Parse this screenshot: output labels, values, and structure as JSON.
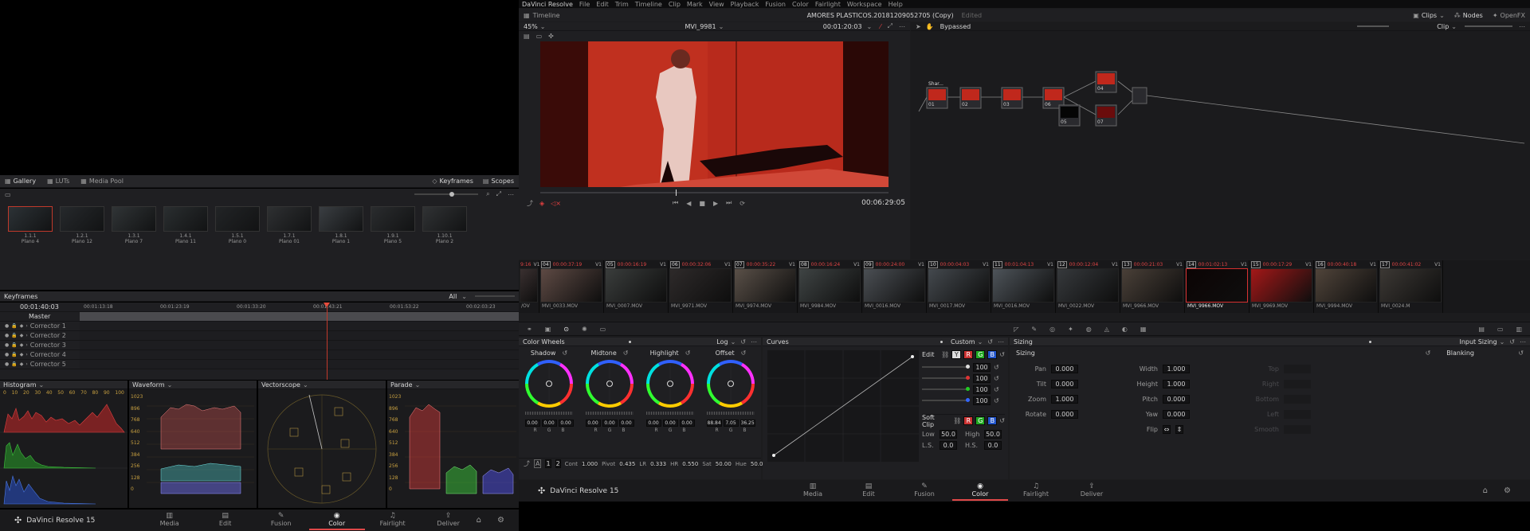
{
  "left": {
    "gallery_tabs": [
      {
        "label": "Gallery",
        "icon": "gallery-icon"
      },
      {
        "label": "LUTs",
        "icon": "lut-icon"
      },
      {
        "label": "Media Pool",
        "icon": "media-pool-icon"
      }
    ],
    "keyframes_btn": "Keyframes",
    "scopes_btn": "Scopes",
    "stills": [
      {
        "id": "1.1.1",
        "name": "Plano 4"
      },
      {
        "id": "1.2.1",
        "name": "Plano 12"
      },
      {
        "id": "1.3.1",
        "name": "Plano 7"
      },
      {
        "id": "1.4.1",
        "name": "Plano 11"
      },
      {
        "id": "1.5.1",
        "name": "Plano 0"
      },
      {
        "id": "1.7.1",
        "name": "Plano 01"
      },
      {
        "id": "1.8.1",
        "name": "Plano 1"
      },
      {
        "id": "1.9.1",
        "name": "Plano 5"
      },
      {
        "id": "1.10.1",
        "name": "Plano 2"
      }
    ],
    "keyframes": {
      "title": "Keyframes",
      "filter": "All",
      "timecode": "00:01:40:03",
      "ruler": [
        "00:01:13:18",
        "00:01:23:19",
        "00:01:33:20",
        "00:01:43:21",
        "00:01:53:22",
        "00:02:03:23"
      ],
      "tracks": [
        "Master",
        "Corrector 1",
        "Corrector 2",
        "Corrector 3",
        "Corrector 4",
        "Corrector 5"
      ]
    },
    "scopes": {
      "histogram": "Histogram",
      "histogram_axis": [
        "0",
        "10",
        "20",
        "30",
        "40",
        "50",
        "60",
        "70",
        "80",
        "90",
        "100"
      ],
      "waveform": "Waveform",
      "vectorscope": "Vectorscope",
      "parade": "Parade",
      "levels": [
        "1023",
        "896",
        "768",
        "640",
        "512",
        "384",
        "256",
        "128",
        "0"
      ]
    },
    "footer": {
      "app": "DaVinci Resolve 15",
      "pages": [
        "Media",
        "Edit",
        "Fusion",
        "Color",
        "Fairlight",
        "Deliver"
      ],
      "active": "Color"
    }
  },
  "menu": [
    "DaVinci Resolve",
    "File",
    "Edit",
    "Trim",
    "Timeline",
    "Clip",
    "Mark",
    "View",
    "Playback",
    "Fusion",
    "Color",
    "Fairlight",
    "Workspace",
    "Help"
  ],
  "titlebar": {
    "timeline": "Timeline",
    "project": "AMORES PLASTICOS.20181209052705 (Copy)",
    "status": "Edited",
    "clips": "Clips",
    "nodes": "Nodes",
    "openfx": "OpenFX"
  },
  "viewer": {
    "zoom": "45%",
    "clip": "MVI_9981",
    "tc_top": "00:01:20:03",
    "timecode": "00:06:29:05",
    "bypassed": "Bypassed",
    "clip_mode": "Clip"
  },
  "nodes": [
    {
      "num": "01",
      "label": "Shar..."
    },
    {
      "num": "02"
    },
    {
      "num": "03"
    },
    {
      "num": "06"
    },
    {
      "num": "04"
    },
    {
      "num": "05"
    },
    {
      "num": "07"
    }
  ],
  "strip": [
    {
      "n": "",
      "tc": "9:16",
      "track": "V1",
      "name": "/OV",
      "color": "#3a3030"
    },
    {
      "n": "04",
      "tc": "00:00:37:19",
      "track": "V1",
      "name": "MVI_0033.MOV",
      "color": "#5e4a44"
    },
    {
      "n": "05",
      "tc": "00:00:16:19",
      "track": "V1",
      "name": "MVI_0007.MOV",
      "color": "#3a3d3c"
    },
    {
      "n": "06",
      "tc": "00:00:32:06",
      "track": "V1",
      "name": "MVI_9971.MOV",
      "color": "#2e2a2a"
    },
    {
      "n": "07",
      "tc": "00:00:35:22",
      "track": "V1",
      "name": "MVI_9974.MOV",
      "color": "#5a5048"
    },
    {
      "n": "08",
      "tc": "00:00:16:24",
      "track": "V1",
      "name": "MVI_9984.MOV",
      "color": "#3f4444"
    },
    {
      "n": "09",
      "tc": "00:00:24:00",
      "track": "V1",
      "name": "MVI_0016.MOV",
      "color": "#4b4f54"
    },
    {
      "n": "10",
      "tc": "00:00:04:03",
      "track": "V1",
      "name": "MVI_0017.MOV",
      "color": "#44494e"
    },
    {
      "n": "11",
      "tc": "00:01:04:13",
      "track": "V1",
      "name": "MVI_0016.MOV",
      "color": "#4e545a"
    },
    {
      "n": "12",
      "tc": "00:00:12:04",
      "track": "V1",
      "name": "MVI_0022.MOV",
      "color": "#36393c"
    },
    {
      "n": "13",
      "tc": "00:00:21:03",
      "track": "V1",
      "name": "MVI_9966.MOV",
      "color": "#4a4038"
    },
    {
      "n": "14",
      "tc": "00:01:02:13",
      "track": "V1",
      "name": "MVI_9966.MOV",
      "color": "#0c0404",
      "active": true
    },
    {
      "n": "15",
      "tc": "00:00:17:29",
      "track": "V1",
      "name": "MVI_9969.MOV",
      "color": "#a41818"
    },
    {
      "n": "16",
      "tc": "00:00:40:18",
      "track": "V1",
      "name": "MVI_9994.MOV",
      "color": "#50443a"
    },
    {
      "n": "17",
      "tc": "00:00:41:02",
      "track": "V1",
      "name": "MVI_0024.M",
      "color": "#3c3834"
    }
  ],
  "wheels": {
    "title": "Color Wheels",
    "mode": "Log",
    "items": [
      {
        "name": "Shadow",
        "vals": [
          "0.00",
          "0.00",
          "0.00"
        ]
      },
      {
        "name": "Midtone",
        "vals": [
          "0.00",
          "0.00",
          "0.00"
        ]
      },
      {
        "name": "Highlight",
        "vals": [
          "0.00",
          "0.00",
          "0.00"
        ]
      },
      {
        "name": "Offset",
        "vals": [
          "88.84",
          "7.05",
          "36.25"
        ]
      }
    ],
    "rgb": [
      "R",
      "G",
      "B"
    ],
    "bottom": {
      "p1": "1",
      "p2": "2",
      "cont_l": "Cont",
      "cont": "1.000",
      "pivot_l": "Pivot",
      "pivot": "0.435",
      "lr_l": "LR",
      "lr": "0.333",
      "hr_l": "HR",
      "hr": "0.550",
      "sat_l": "Sat",
      "sat": "50.00",
      "hue_l": "Hue",
      "hue": "50.00"
    }
  },
  "curves": {
    "title": "Curves",
    "mode": "Custom",
    "edit": "Edit",
    "y": "Y",
    "r": "R",
    "g": "G",
    "b": "B",
    "vals": [
      "100",
      "100",
      "100",
      "100"
    ],
    "soft": "Soft Clip",
    "low_l": "Low",
    "low": "50.0",
    "high_l": "High",
    "high": "50.0",
    "ls_l": "L.S.",
    "ls": "0.0",
    "hs_l": "H.S.",
    "hs": "0.0"
  },
  "sizing": {
    "title": "Sizing",
    "mode": "Input Sizing",
    "label": "Sizing",
    "blanking": "Blanking",
    "left": [
      {
        "l": "Pan",
        "v": "0.000"
      },
      {
        "l": "Tilt",
        "v": "0.000"
      },
      {
        "l": "Zoom",
        "v": "1.000"
      },
      {
        "l": "Rotate",
        "v": "0.000"
      }
    ],
    "right": [
      {
        "l": "Width",
        "v": "1.000"
      },
      {
        "l": "Height",
        "v": "1.000"
      },
      {
        "l": "Pitch",
        "v": "0.000"
      },
      {
        "l": "Yaw",
        "v": "0.000"
      },
      {
        "l": "Flip",
        "v": ""
      }
    ],
    "blank": [
      "Top",
      "Right",
      "Bottom",
      "Left",
      "Smooth"
    ]
  },
  "footer": {
    "app": "DaVinci Resolve 15",
    "pages": [
      "Media",
      "Edit",
      "Fusion",
      "Color",
      "Fairlight",
      "Deliver"
    ],
    "active": "Color"
  }
}
